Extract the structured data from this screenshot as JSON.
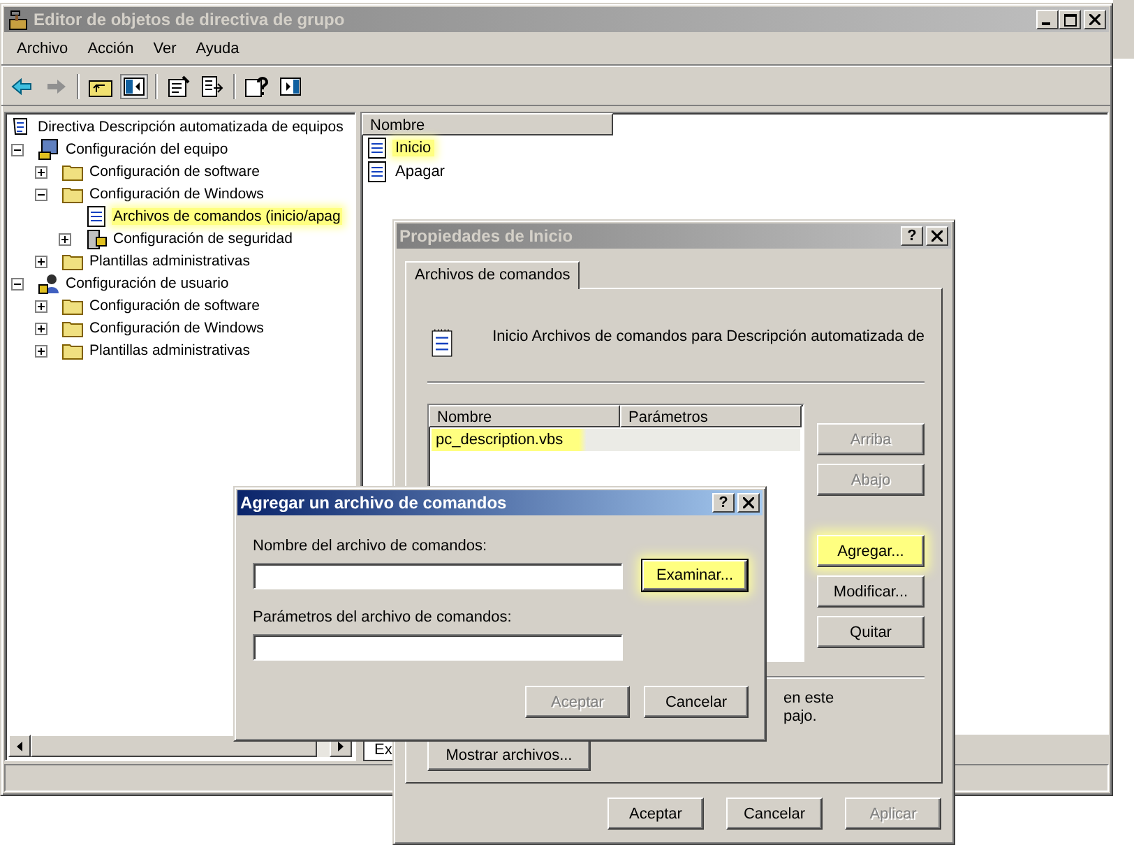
{
  "window": {
    "title": "Editor de objetos de directiva de grupo",
    "active": false
  },
  "menu": [
    "Archivo",
    "Acción",
    "Ver",
    "Ayuda"
  ],
  "tree": [
    {
      "label": "Directiva Descripción automatizada de equipos",
      "kind": "policy",
      "highlighted": false,
      "children": [
        {
          "label": "Configuración del equipo",
          "kind": "computer",
          "expanded": true,
          "highlighted": false,
          "children": [
            {
              "label": "Configuración de software",
              "kind": "folder",
              "expanded": false,
              "highlighted": false
            },
            {
              "label": "Configuración de Windows",
              "kind": "folder",
              "expanded": true,
              "highlighted": false,
              "children": [
                {
                  "label": "Archivos de comandos (inicio/apag",
                  "kind": "script",
                  "highlighted": true
                },
                {
                  "label": "Configuración de seguridad",
                  "kind": "security",
                  "expanded": false,
                  "highlighted": false
                }
              ]
            },
            {
              "label": "Plantillas administrativas",
              "kind": "folder",
              "expanded": false,
              "highlighted": false
            }
          ]
        },
        {
          "label": "Configuración de usuario",
          "kind": "user",
          "expanded": true,
          "highlighted": false,
          "children": [
            {
              "label": "Configuración de software",
              "kind": "folder",
              "expanded": false,
              "highlighted": false
            },
            {
              "label": "Configuración de Windows",
              "kind": "folder",
              "expanded": false,
              "highlighted": false
            },
            {
              "label": "Plantillas administrativas",
              "kind": "folder",
              "expanded": false,
              "highlighted": false
            }
          ]
        }
      ]
    }
  ],
  "list": {
    "columns": [
      "Nombre"
    ],
    "rows": [
      {
        "label": "Inicio",
        "highlighted": true
      },
      {
        "label": "Apagar",
        "highlighted": false
      }
    ]
  },
  "bottom_tab": "Ex",
  "properties_dialog": {
    "title": "Propiedades de Inicio",
    "active": false,
    "help_button": "?",
    "tabs": [
      {
        "label": "Archivos de comandos",
        "selected": true
      }
    ],
    "description": "Inicio Archivos de comandos para Descripción automatizada de",
    "table": {
      "columns": [
        "Nombre",
        "Parámetros"
      ],
      "rows": [
        {
          "name": "pc_description.vbs",
          "highlighted": true
        }
      ]
    },
    "side_buttons": [
      {
        "label": "Arriba",
        "disabled": true,
        "highlighted": false
      },
      {
        "label": "Abajo",
        "disabled": true,
        "highlighted": false
      },
      {
        "label": "Agregar...",
        "disabled": false,
        "highlighted": true
      },
      {
        "label": "Modificar...",
        "disabled": false,
        "highlighted": false
      },
      {
        "label": "Quitar",
        "disabled": false,
        "highlighted": false
      }
    ],
    "note_lines": [
      "en este",
      "pajo."
    ],
    "show_files_button": "Mostrar archivos...",
    "buttons": [
      {
        "label": "Aceptar",
        "disabled": false
      },
      {
        "label": "Cancelar",
        "disabled": false
      },
      {
        "label": "Aplicar",
        "disabled": true
      }
    ]
  },
  "add_dialog": {
    "title": "Agregar un archivo de comandos",
    "active": true,
    "help_button": "?",
    "fields": [
      {
        "label": "Nombre del archivo de comandos:"
      },
      {
        "label": "Parámetros del archivo de comandos:"
      }
    ],
    "browse_button": {
      "label": "Examinar...",
      "highlighted": true
    },
    "buttons": [
      {
        "label": "Aceptar",
        "disabled": true
      },
      {
        "label": "Cancelar",
        "disabled": false
      }
    ]
  }
}
